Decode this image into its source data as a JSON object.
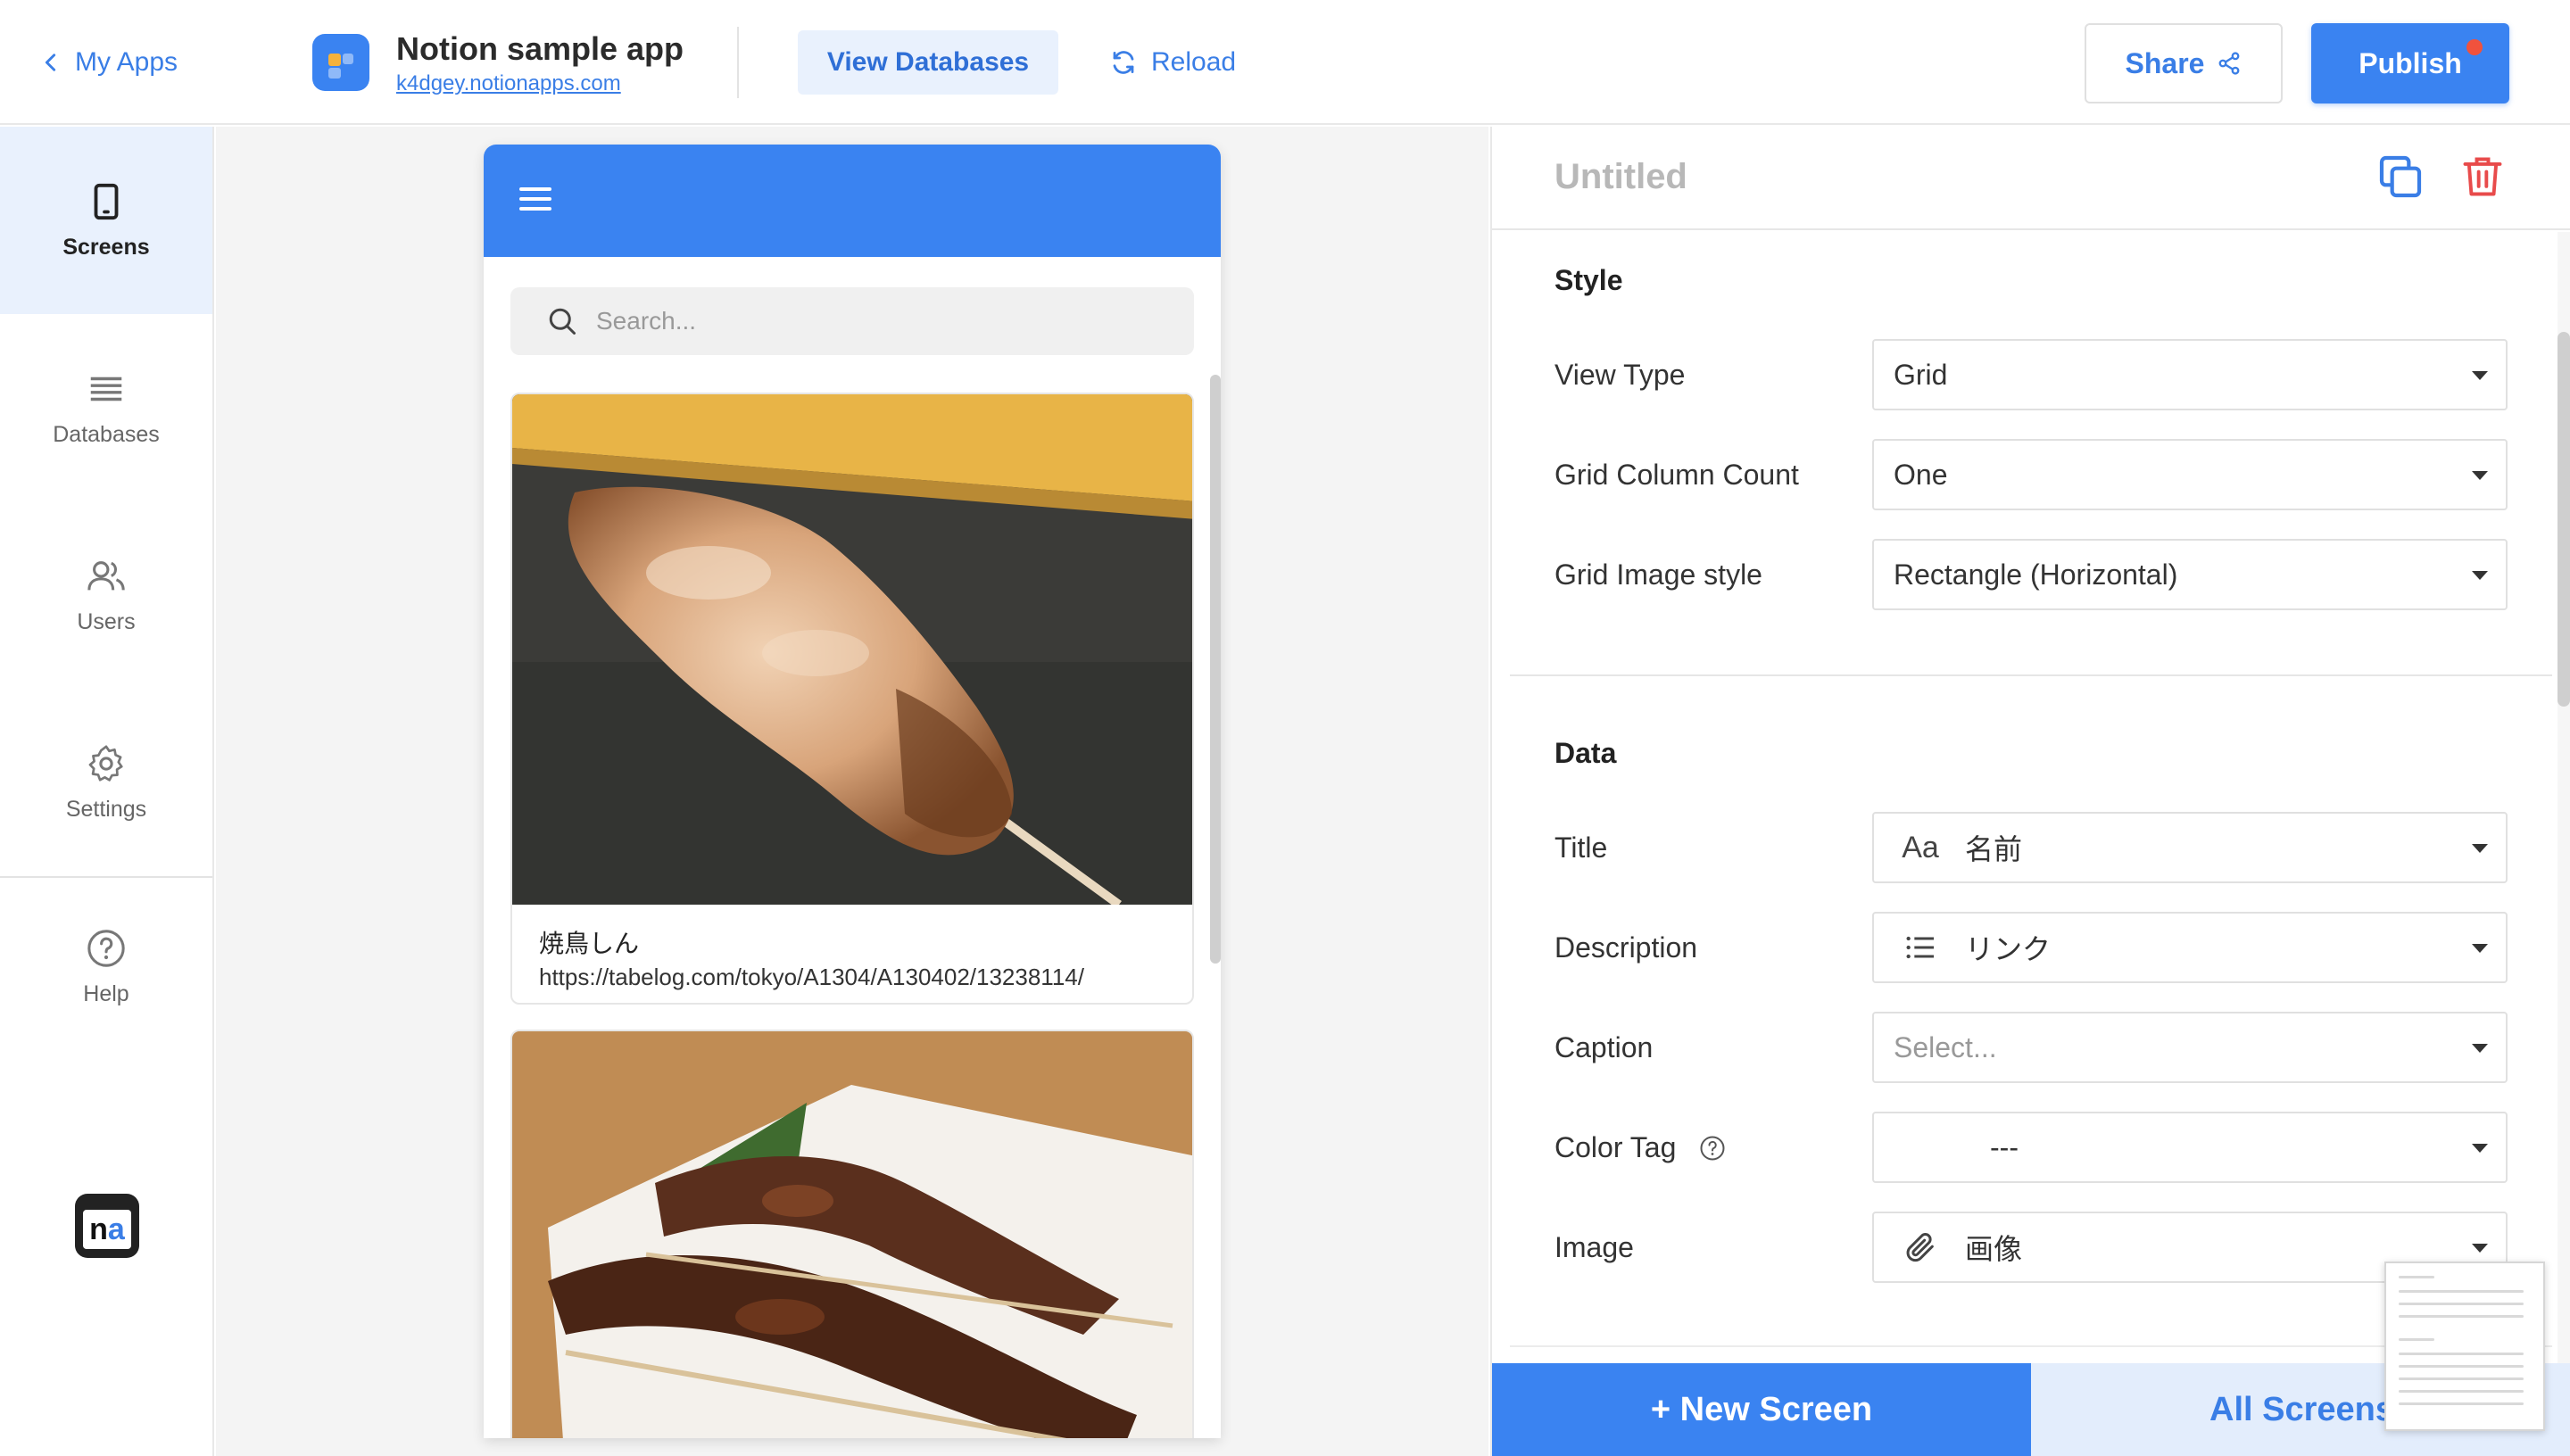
{
  "topbar": {
    "back_label": "My Apps",
    "app_name": "Notion sample app",
    "app_url": "k4dgey.notionapps.com",
    "view_databases_label": "View Databases",
    "reload_label": "Reload",
    "share_label": "Share",
    "publish_label": "Publish",
    "publish_indicator_color": "#f0523d"
  },
  "sidebar": {
    "items": [
      {
        "label": "Screens",
        "icon": "phone-icon",
        "active": true
      },
      {
        "label": "Databases",
        "icon": "list-icon",
        "active": false
      },
      {
        "label": "Users",
        "icon": "users-icon",
        "active": false
      },
      {
        "label": "Settings",
        "icon": "gear-icon",
        "active": false
      },
      {
        "label": "Help",
        "icon": "help-icon",
        "active": false
      }
    ],
    "logo_text_n": "n",
    "logo_text_a": "a"
  },
  "preview": {
    "search_placeholder": "Search...",
    "cards": [
      {
        "title": "焼鳥しん",
        "description": "https://tabelog.com/tokyo/A1304/A130402/13238114/"
      },
      {
        "title": "",
        "description": ""
      }
    ]
  },
  "panel": {
    "title": "Untitled",
    "style_heading": "Style",
    "style_fields": [
      {
        "label": "View Type",
        "value": "Grid"
      },
      {
        "label": "Grid Column Count",
        "value": "One"
      },
      {
        "label": "Grid Image style",
        "value": "Rectangle (Horizontal)"
      }
    ],
    "data_heading": "Data",
    "data_fields": [
      {
        "label": "Title",
        "icon_text": "Aa",
        "value": "名前"
      },
      {
        "label": "Description",
        "icon": "list-bullets-icon",
        "value": "リンク"
      },
      {
        "label": "Caption",
        "value": "Select..."
      },
      {
        "label": "Color Tag",
        "value": "---"
      },
      {
        "label": "Image",
        "icon": "paperclip-icon",
        "value": "画像"
      }
    ],
    "new_screen_label": "+ New Screen",
    "all_screens_label": "All Screens"
  },
  "colors": {
    "accent": "#3a83f1",
    "link": "#3a7ee6",
    "active_bg": "#e9f1fd",
    "danger": "#e84b4b"
  }
}
